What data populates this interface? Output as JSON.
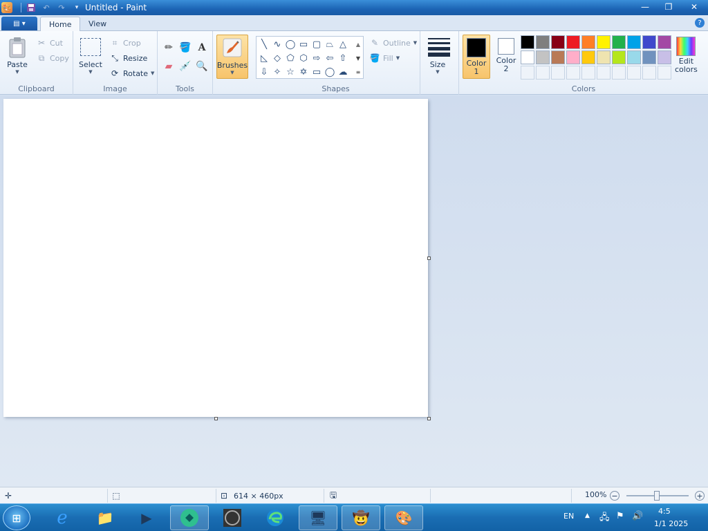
{
  "window": {
    "title": "Untitled - Paint",
    "controls": {
      "minimize": "—",
      "maximize": "❐",
      "close": "✕"
    }
  },
  "qat": {
    "save_icon": "save-icon",
    "undo_icon": "undo-icon",
    "redo_icon": "redo-icon",
    "customize_icon": "dropdown-icon"
  },
  "tabs": {
    "file": "▤ ▾",
    "home": "Home",
    "view": "View",
    "help": "?"
  },
  "ribbon": {
    "clipboard": {
      "label": "Clipboard",
      "paste": "Paste",
      "cut": "Cut",
      "copy": "Copy"
    },
    "image": {
      "label": "Image",
      "select": "Select",
      "crop": "Crop",
      "resize": "Resize",
      "rotate": "Rotate"
    },
    "tools": {
      "label": "Tools"
    },
    "brushes": {
      "label": "Brushes"
    },
    "shapes": {
      "label": "Shapes",
      "outline": "Outline",
      "fill": "Fill"
    },
    "size": {
      "label": "Size"
    },
    "colors": {
      "label": "Colors",
      "color1_label_a": "Color",
      "color1_label_b": "1",
      "color2_label_a": "Color",
      "color2_label_b": "2",
      "color1": "#000000",
      "color2": "#ffffff",
      "edit_a": "Edit",
      "edit_b": "colors",
      "palette_row1": [
        "#000000",
        "#7f7f7f",
        "#880015",
        "#ed1c24",
        "#ff7f27",
        "#fff200",
        "#22b14c",
        "#00a2e8",
        "#3f48cc",
        "#a349a4"
      ],
      "palette_row2": [
        "#ffffff",
        "#c3c3c3",
        "#b97a57",
        "#ffaec9",
        "#ffc90e",
        "#efe4b0",
        "#b5e61d",
        "#99d9ea",
        "#7092be",
        "#c8bfe7"
      ]
    }
  },
  "statusbar": {
    "canvas_size": "614 × 460px",
    "zoom": "100%"
  },
  "taskbar": {
    "language": "EN",
    "time": "4:5",
    "date": "1/1 2025"
  }
}
